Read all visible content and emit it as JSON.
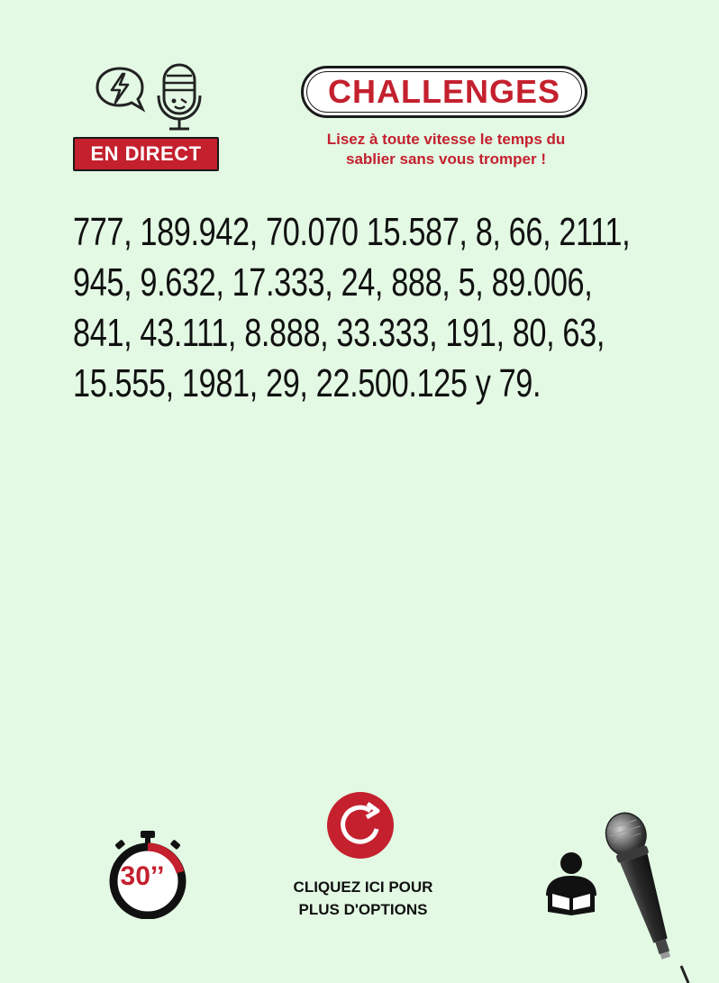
{
  "header": {
    "live_label": "EN DIRECT",
    "title": "CHALLENGES",
    "subtitle_line1": "Lisez à toute vitesse le temps du",
    "subtitle_line2": "sablier sans vous tromper !"
  },
  "content": {
    "numbers_line1": "777, 189.942, 70.070 15.587, 8, 66, 2111,",
    "numbers_line2": "945, 9.632, 17.333, 24, 888, 5, 89.006,",
    "numbers_line3": "841, 43.111, 8.888, 33.333, 191, 80, 63,",
    "numbers_line4": "15.555, 1981, 29, 22.500.125 y 79."
  },
  "footer": {
    "timer_label": "30’’",
    "options_line1": "CLIQUEZ ICI POUR",
    "options_line2": "PLUS D'OPTIONS"
  },
  "icons": {
    "bolt": "lightning-speech-bubble-icon",
    "podcast_mic": "microphone-icon",
    "timer": "stopwatch-icon",
    "refresh": "refresh-icon",
    "reader": "person-reading-icon",
    "handheld_mic": "handheld-microphone-icon"
  },
  "colors": {
    "background": "#e3f9e4",
    "accent_red": "#c4202e",
    "text_dark": "#111111"
  }
}
